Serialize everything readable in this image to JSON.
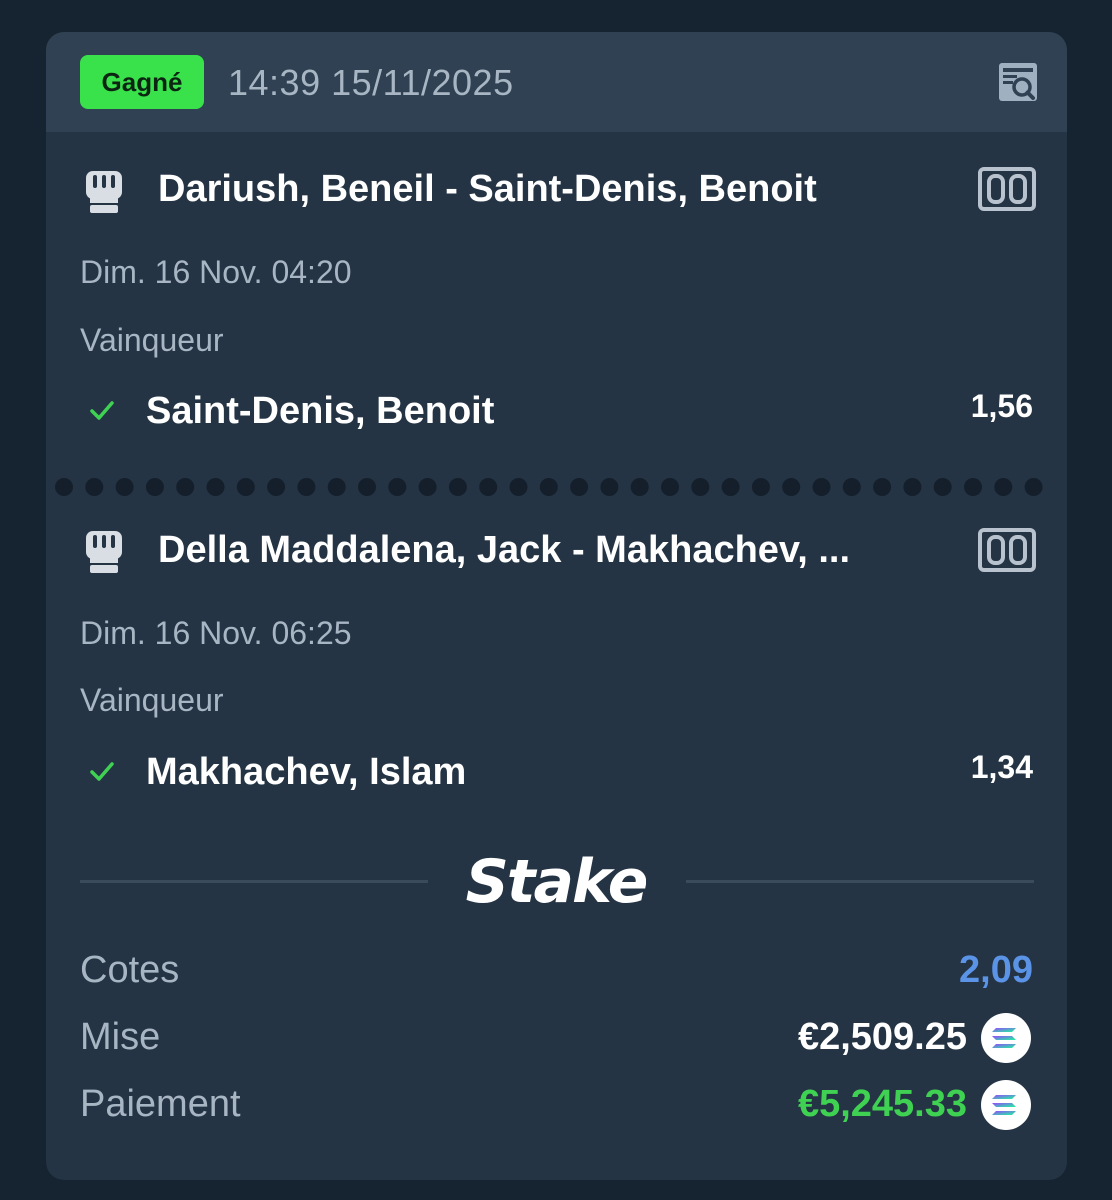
{
  "header": {
    "status_badge": "Gagné",
    "timestamp": "14:39 15/11/2025",
    "receipt_icon": "receipt-search-icon"
  },
  "legs": [
    {
      "sport_icon": "fist-icon",
      "title": "Dariush, Beneil - Saint-Denis, Benoit",
      "date": "Dim. 16 Nov.  04:20",
      "market": "Vainqueur",
      "selection": "Saint-Denis, Benoit",
      "odds": "1,56",
      "status_icon": "check-icon"
    },
    {
      "sport_icon": "fist-icon",
      "title": "Della Maddalena, Jack - Makhachev, ...",
      "date": "Dim. 16 Nov.  06:25",
      "market": "Vainqueur",
      "selection": "Makhachev, Islam",
      "odds": "1,34",
      "status_icon": "check-icon"
    }
  ],
  "brand": {
    "logo_text": "Stake"
  },
  "summary": {
    "odds_label": "Cotes",
    "odds_value": "2,09",
    "stake_label": "Mise",
    "stake_value": "€2,509.25",
    "payout_label": "Paiement",
    "payout_value": "€5,245.33",
    "currency_icon": "solana-icon"
  },
  "colors": {
    "background": "#162330",
    "card": "#243444",
    "header": "#2f4152",
    "won_badge": "#39e14a",
    "odds_total": "#5b94e6",
    "payout": "#3fd152",
    "check": "#3fd152"
  }
}
